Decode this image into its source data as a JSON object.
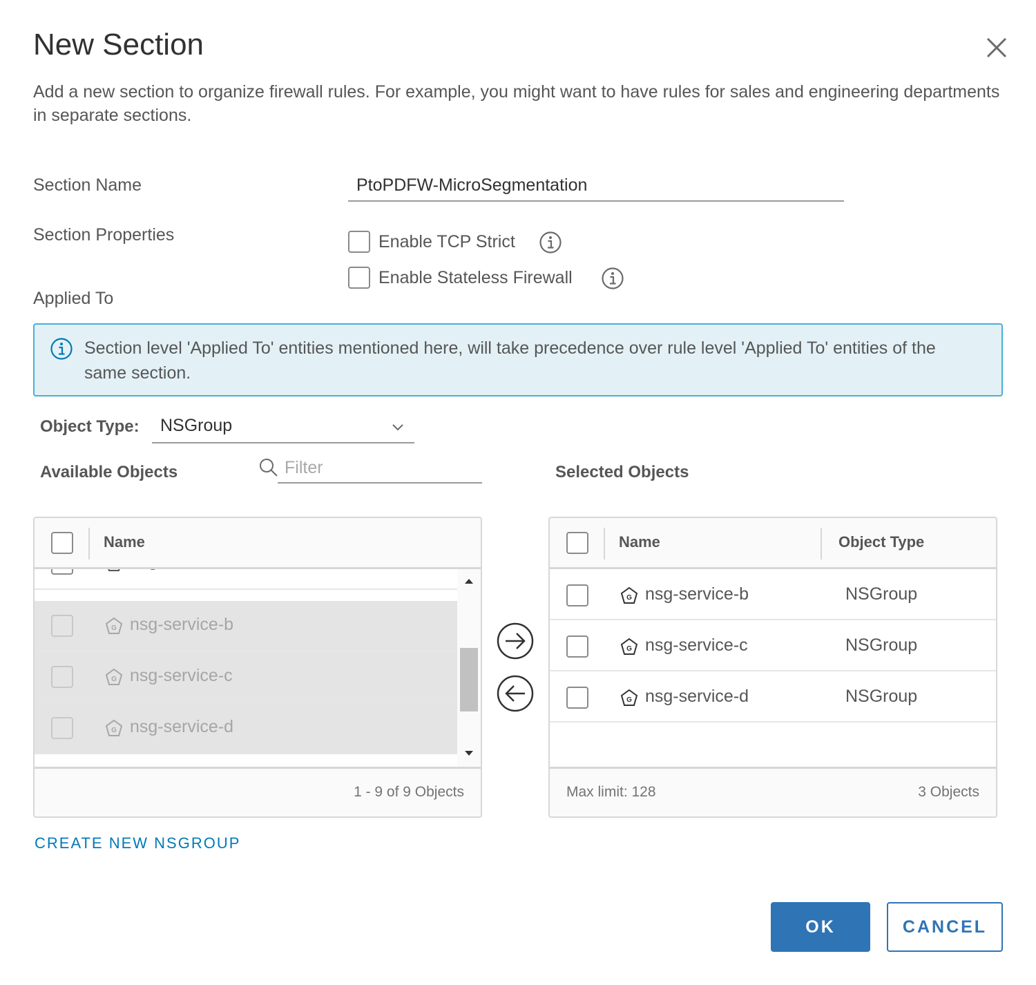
{
  "dialog": {
    "title": "New Section",
    "description": "Add a new section to organize firewall rules. For example, you might want to have rules for sales and engineering departments in separate sections."
  },
  "form": {
    "section_name_label": "Section Name",
    "section_name_value": "PtoPDFW-MicroSegmentation",
    "section_properties_label": "Section Properties",
    "enable_tcp_strict_label": "Enable TCP Strict",
    "enable_stateless_label": "Enable Stateless Firewall",
    "applied_to_label": "Applied To"
  },
  "alert": {
    "text": "Section level 'Applied To' entities mentioned here, will take precedence over rule level 'Applied To' entities of the same section."
  },
  "object_type": {
    "label": "Object Type:",
    "value": "NSGroup"
  },
  "available": {
    "label": "Available Objects",
    "filter_placeholder": "Filter",
    "col_name": "Name",
    "rows": [
      {
        "name": "nsg-service-a"
      },
      {
        "name": "nsg-service-b"
      },
      {
        "name": "nsg-service-c"
      },
      {
        "name": "nsg-service-d"
      }
    ],
    "footer": "1 - 9 of 9 Objects"
  },
  "selected": {
    "label": "Selected Objects",
    "col_name": "Name",
    "col_type": "Object Type",
    "rows": [
      {
        "name": "nsg-service-b",
        "type": "NSGroup"
      },
      {
        "name": "nsg-service-c",
        "type": "NSGroup"
      },
      {
        "name": "nsg-service-d",
        "type": "NSGroup"
      }
    ],
    "footer_left": "Max limit: 128",
    "footer_right": "3 Objects"
  },
  "actions": {
    "create_link": "CREATE NEW NSGROUP",
    "ok": "OK",
    "cancel": "CANCEL"
  },
  "colors": {
    "primary": "#2f74b5",
    "link": "#0079b8",
    "alert_bg": "#e3f1f6",
    "alert_border": "#49afd9",
    "disabled_row": "#e4e4e4"
  },
  "icons": [
    "close-icon",
    "info-icon",
    "chevron-down-icon",
    "search-icon",
    "nsgroup-icon",
    "arrow-right-icon",
    "arrow-left-icon",
    "scroll-up-icon",
    "scroll-down-icon"
  ]
}
